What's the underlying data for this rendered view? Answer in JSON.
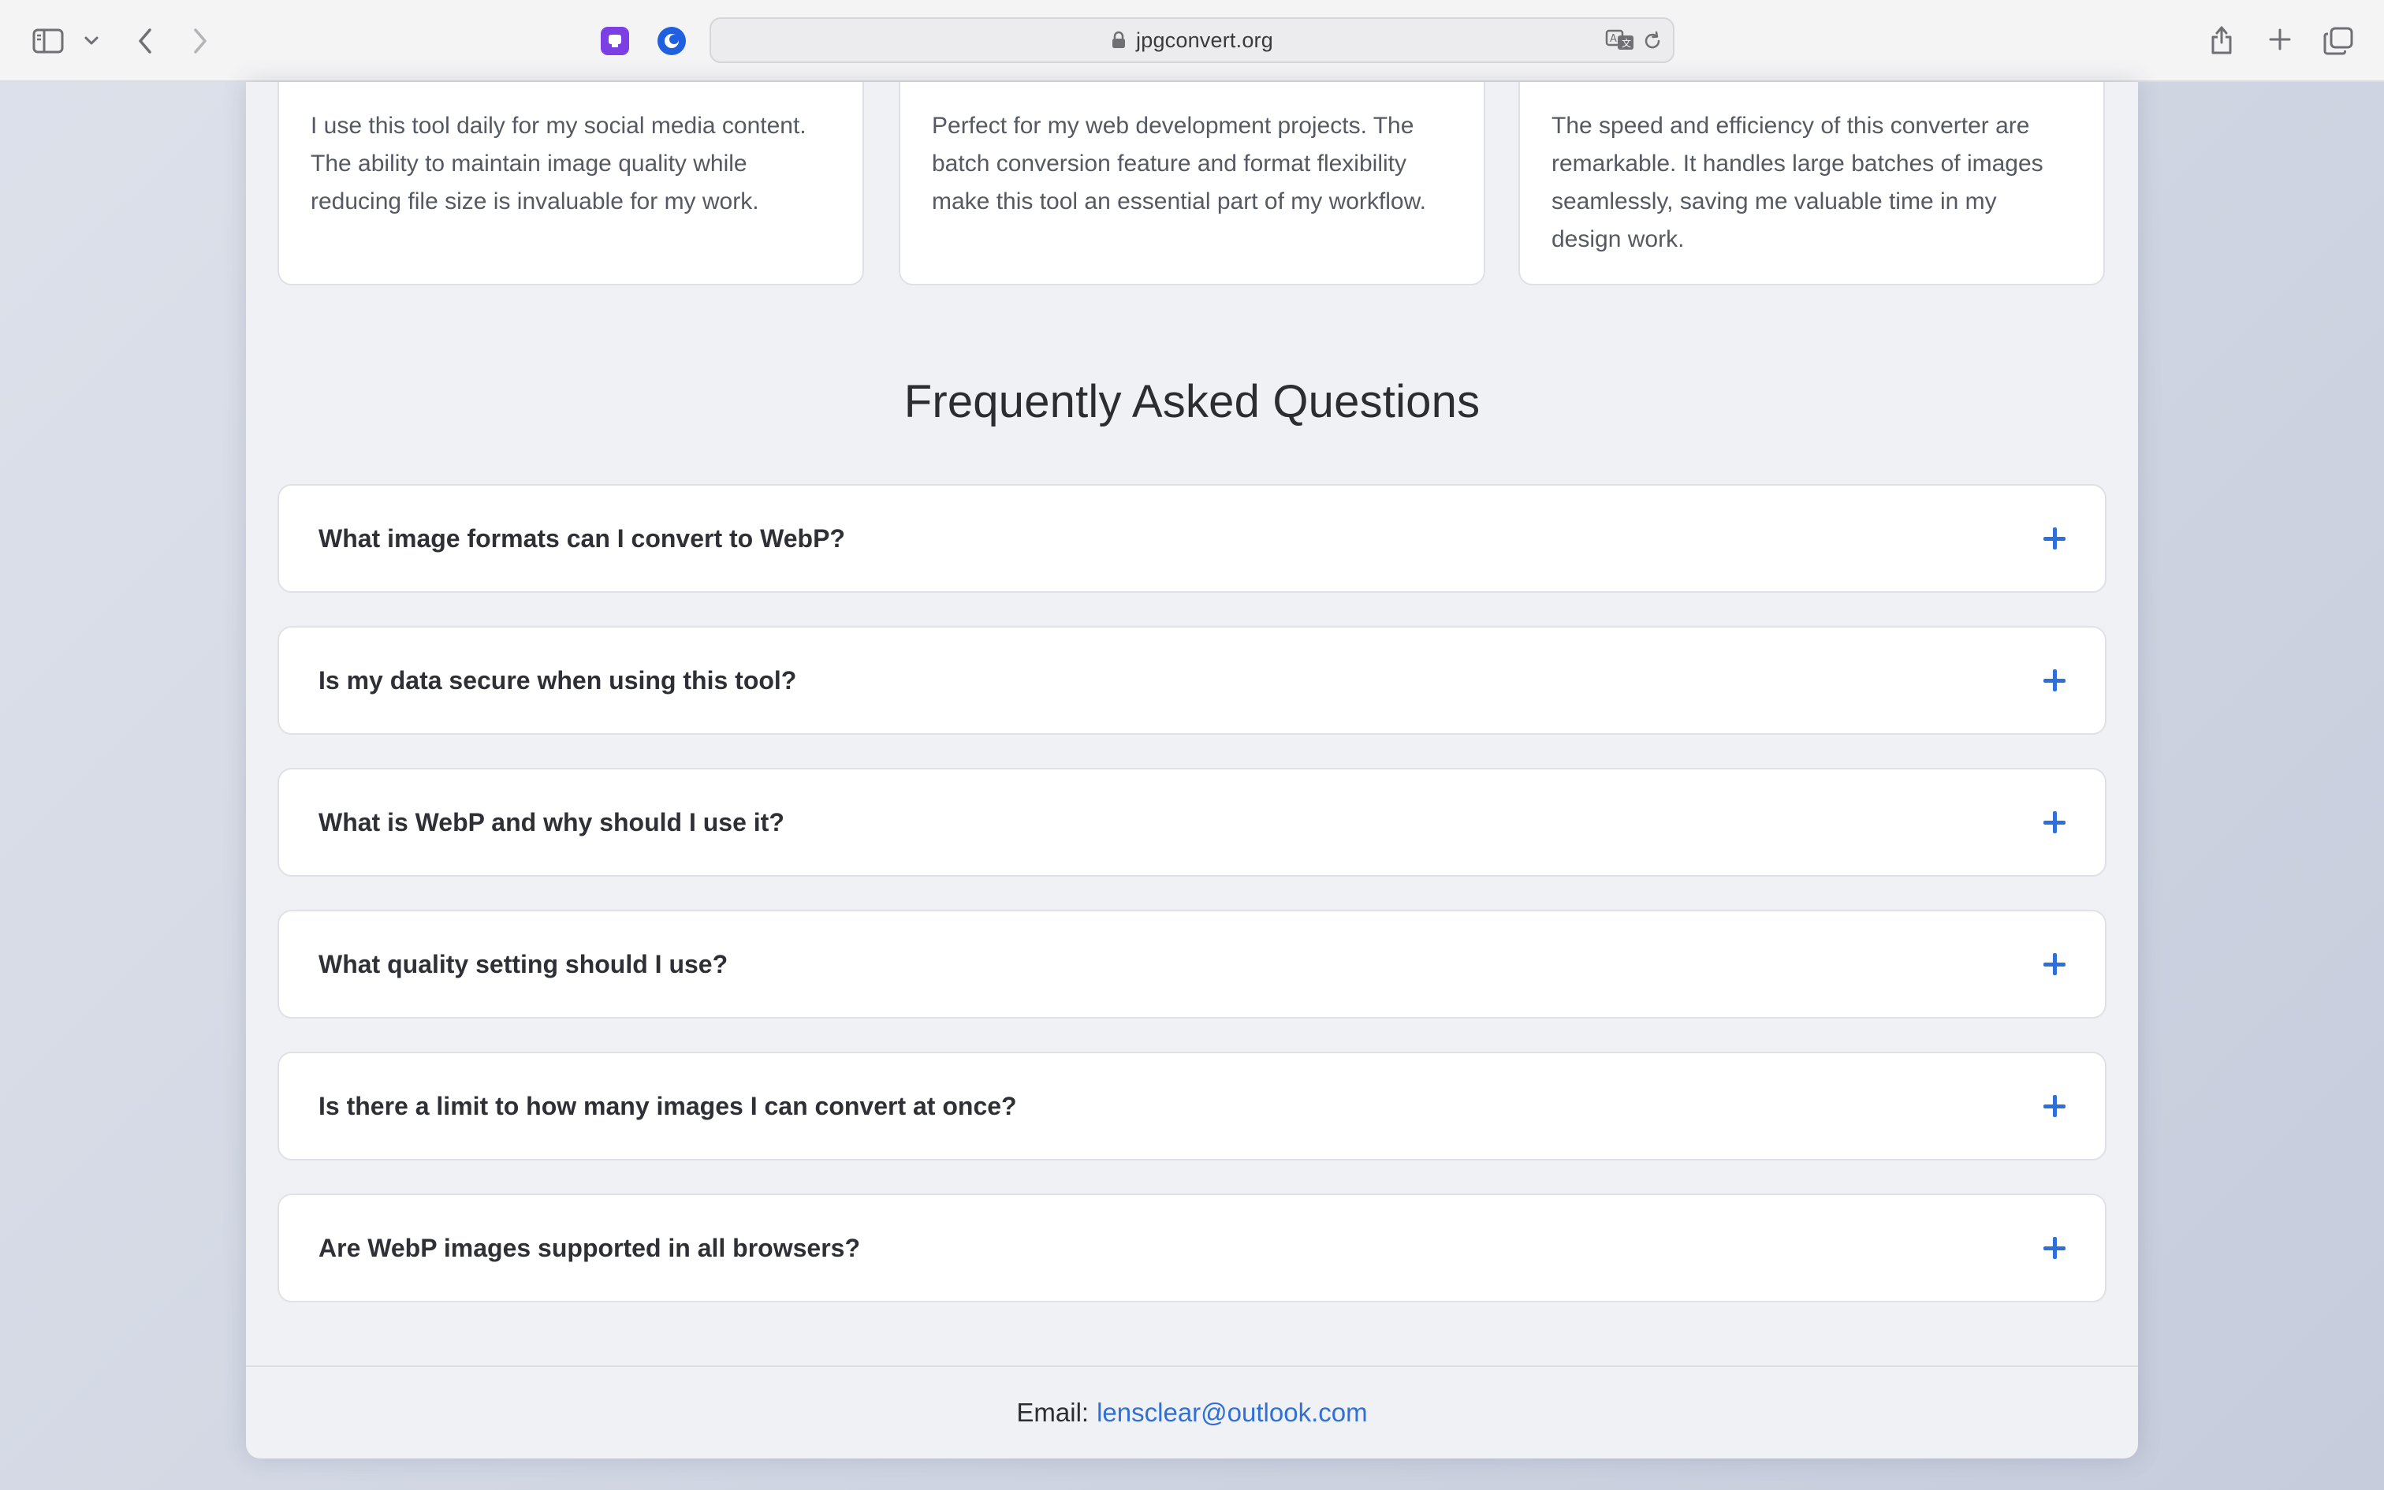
{
  "browser": {
    "url": "jpgconvert.org"
  },
  "testimonials": [
    {
      "text": "I use this tool daily for my social media content. The ability to maintain image quality while reducing file size is invaluable for my work."
    },
    {
      "text": "Perfect for my web development projects. The batch conversion feature and format flexibility make this tool an essential part of my workflow."
    },
    {
      "text": "The speed and efficiency of this converter are remarkable. It handles large batches of images seamlessly, saving me valuable time in my design work."
    }
  ],
  "faq": {
    "heading": "Frequently Asked Questions",
    "items": [
      {
        "question": "What image formats can I convert to WebP?"
      },
      {
        "question": "Is my data secure when using this tool?"
      },
      {
        "question": "What is WebP and why should I use it?"
      },
      {
        "question": "What quality setting should I use?"
      },
      {
        "question": "Is there a limit to how many images I can convert at once?"
      },
      {
        "question": "Are WebP images supported in all browsers?"
      }
    ]
  },
  "footer": {
    "email_label": "Email:",
    "email": "lensclear@outlook.com"
  },
  "colors": {
    "accent": "#2f6fd8",
    "page_bg": "#f0f1f4",
    "card_bg": "#ffffff"
  }
}
